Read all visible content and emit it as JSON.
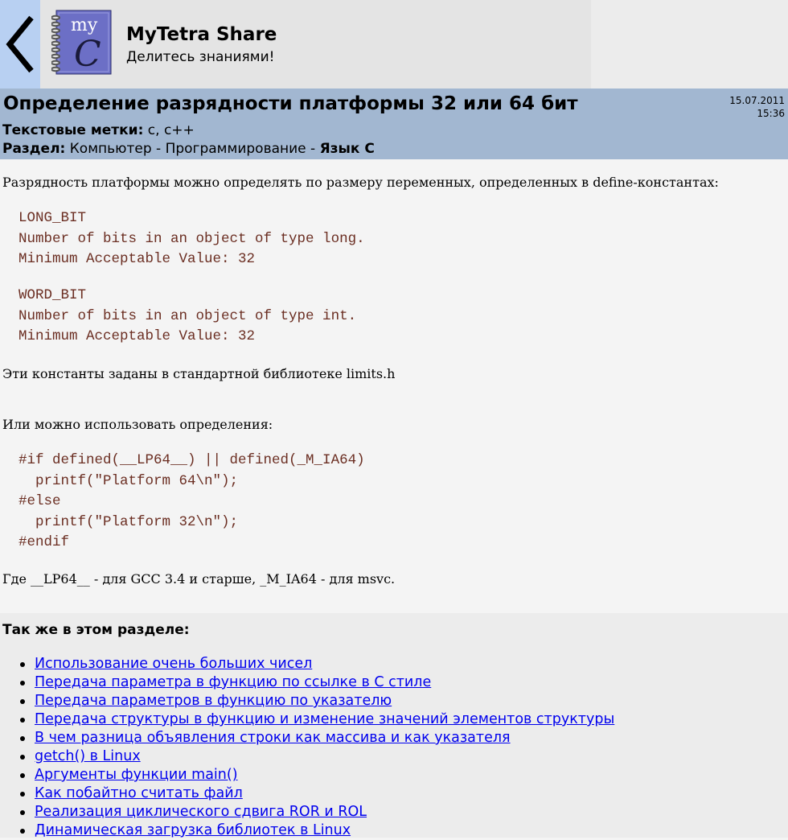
{
  "header": {
    "back_icon": "chevron-left-icon",
    "logo_text": "my",
    "logo_letter": "C",
    "title": "MyTetra Share",
    "subtitle": "Делитесь знаниями!"
  },
  "article": {
    "title": "Определение разрядности платформы 32 или 64 бит",
    "date": "15.07.2011",
    "time": "15:36",
    "tags_label": "Текстовые метки:",
    "tags_value": "c, c++",
    "section_label": "Раздел:",
    "section_path": "Компьютер - Программирование - ",
    "section_current": "Язык С",
    "intro": "Разрядность платформы можно определять по размеру переменных, определенных в define-константах:",
    "code_block_1": "LONG_BIT\nNumber of bits in an object of type long.\nMinimum Acceptable Value: 32",
    "code_block_2": "WORD_BIT\nNumber of bits in an object of type int.\nMinimum Acceptable Value: 32",
    "para_limits": "Эти константы заданы в стандартной библиотеке limits.h",
    "para_defs": "Или можно использовать определения:",
    "code_block_3": "#if defined(__LP64__) || defined(_M_IA64)\n  printf(\"Platform 64\\n\");\n#else\n  printf(\"Platform 32\\n\");\n#endif",
    "para_where": "Где __LP64__ - для GCC 3.4 и старше, _M_IA64 - для msvc."
  },
  "related": {
    "heading": "Так же в этом разделе:",
    "items": [
      "Использование очень больших чисел",
      "Передача параметра в функцию по ссылке в С стиле",
      "Передача параметров в функцию по указателю",
      "Передача структуры в функцию и изменение значений элементов структуры",
      "В чем разница объявления строки как массива и как указателя",
      "getch() в Linux",
      "Аргументы функции main()",
      "Как побайтно считать файл",
      "Реализация циклического сдвига ROR и ROL",
      "Динамическая загрузка библиотек в Linux"
    ]
  },
  "colors": {
    "back_button": "#b8d0f2",
    "title_bar": "#a2b7d1",
    "code_text": "#6b2e22",
    "link": "#0000ee"
  }
}
